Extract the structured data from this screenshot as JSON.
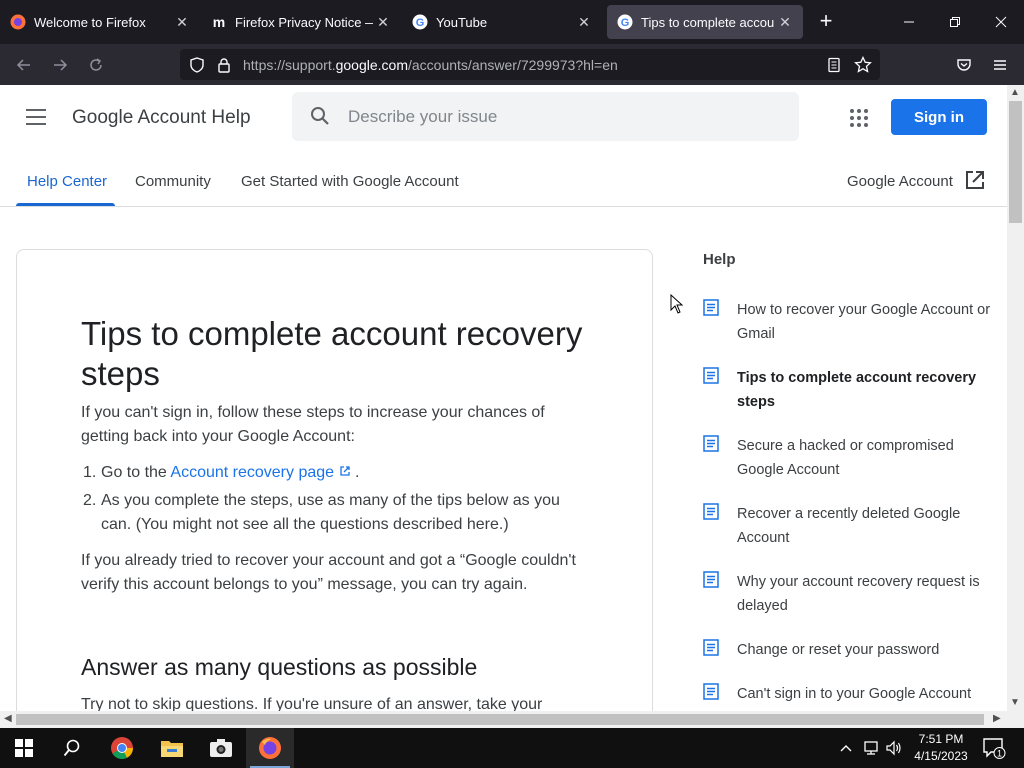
{
  "browser": {
    "tabs": [
      {
        "title": "Welcome to Firefox",
        "favicon": "firefox-icon",
        "active": false
      },
      {
        "title": "Firefox Privacy Notice — M",
        "favicon": "mozilla-icon",
        "active": false
      },
      {
        "title": "YouTube",
        "favicon": "google-icon",
        "active": false
      },
      {
        "title": "Tips to complete account re",
        "favicon": "google-icon",
        "active": true
      }
    ],
    "url_prefix": "https://support.",
    "url_domain": "google.com",
    "url_suffix": "/accounts/answer/7299973?hl=en",
    "close_glyph": "✕",
    "new_tab_glyph": "+"
  },
  "header": {
    "product_title": "Google Account Help",
    "search_placeholder": "Describe your issue",
    "sign_in_label": "Sign in"
  },
  "subnav": {
    "tabs": [
      {
        "label": "Help Center",
        "active": true
      },
      {
        "label": "Community",
        "active": false
      },
      {
        "label": "Get Started with Google Account",
        "active": false
      }
    ],
    "external_link": "Google Account"
  },
  "article": {
    "title": "Tips to complete account recovery steps",
    "intro": "If you can't sign in, follow these steps to increase your chances of getting back into your Google Account:",
    "steps": [
      {
        "num": "1.",
        "before": "Go to the ",
        "link": "Account recovery page",
        "after": " ."
      },
      {
        "num": "2.",
        "text": "As you complete the steps, use as many of the tips below as you can. (You might not see all the questions described here.)"
      }
    ],
    "retry_note": "If you already tried to recover your account and got a “Google couldn't verify this account belongs to you” message, you can try again.",
    "section_heading": "Answer as many questions as possible",
    "section_text": "Try not to skip questions. If you're unsure of an answer, take your"
  },
  "help_sidebar": {
    "title": "Help",
    "items": [
      {
        "label": "How to recover your Google Account or Gmail",
        "current": false
      },
      {
        "label": "Tips to complete account recovery steps",
        "current": true
      },
      {
        "label": "Secure a hacked or compromised Google Account",
        "current": false
      },
      {
        "label": "Recover a recently deleted Google Account",
        "current": false
      },
      {
        "label": "Why your account recovery request is delayed",
        "current": false
      },
      {
        "label": "Change or reset your password",
        "current": false
      },
      {
        "label": "Can't sign in to your Google Account",
        "current": false
      }
    ]
  },
  "taskbar": {
    "time": "7:51 PM",
    "date": "4/15/2023",
    "notification_count": "1"
  },
  "colors": {
    "accent_blue": "#1a73e8",
    "tab_active_blue": "#1967d2",
    "browser_dark": "#1c1b22"
  }
}
